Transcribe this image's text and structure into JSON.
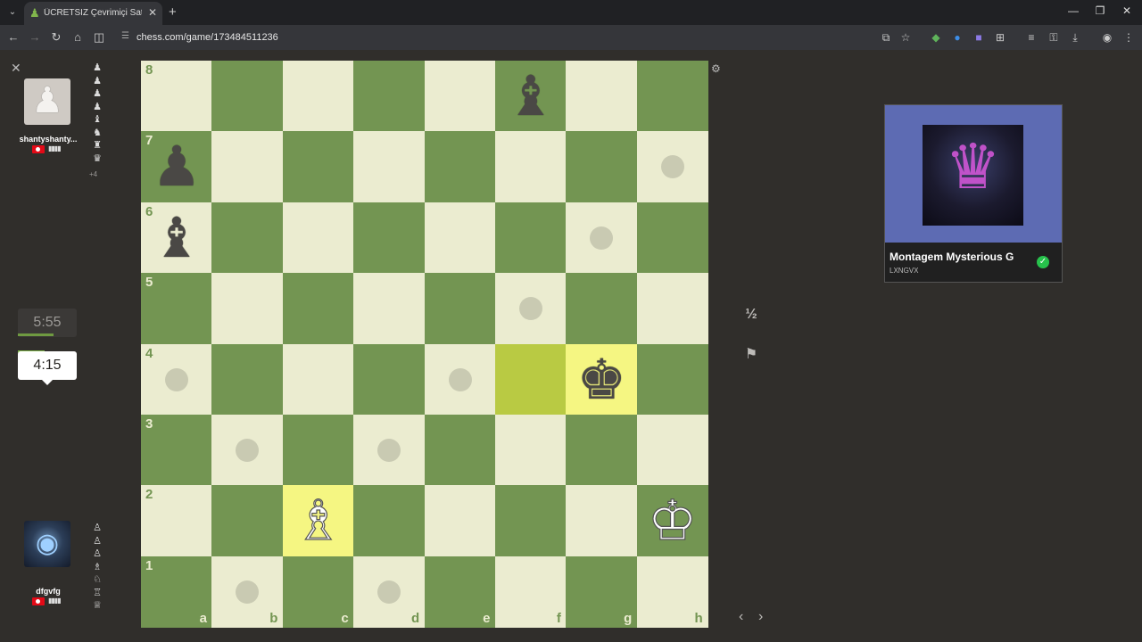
{
  "browser": {
    "tab_title": "ÜCRETSİZ Çevrimiçi Satranç Oy",
    "url": "chess.com/game/173484511236",
    "icons": [
      "tab-list-icon",
      "chess-pawn-favicon",
      "close-icon",
      "plus-icon",
      "minimize-icon",
      "maximize-icon",
      "close-window-icon",
      "back-icon",
      "forward-icon",
      "reload-icon",
      "home-icon",
      "split-view-icon",
      "site-info-icon",
      "install-icon",
      "bookmark-star-icon",
      "extension-icon",
      "extensions-puzzle-icon",
      "password-icon",
      "download-icon",
      "profile-icon",
      "menu-icon"
    ]
  },
  "game": {
    "opponent": {
      "name": "shantyshanty...",
      "clock": "5:55",
      "captured": [
        "♟",
        "♟",
        "♟",
        "♟",
        "♝",
        "♞",
        "♜",
        "♛"
      ],
      "captured_more": "+4"
    },
    "player": {
      "name": "dfgvfg",
      "clock": "4:15",
      "captured": [
        "♙",
        "♙",
        "♙",
        "♗",
        "♘",
        "♖",
        "♕"
      ]
    },
    "board": {
      "light": "#ebecd0",
      "dark": "#739552",
      "highlight_light": "#f5f682",
      "highlight_dark": "#b9ca43",
      "ranks": [
        "8",
        "7",
        "6",
        "5",
        "4",
        "3",
        "2",
        "1"
      ],
      "files": [
        "a",
        "b",
        "c",
        "d",
        "e",
        "f",
        "g",
        "h"
      ],
      "pieces": [
        {
          "square": "f8",
          "glyph": "♝",
          "color": "black"
        },
        {
          "square": "a7",
          "glyph": "♟",
          "color": "black"
        },
        {
          "square": "a6",
          "glyph": "♝",
          "color": "black"
        },
        {
          "square": "g4",
          "glyph": "♚",
          "color": "black"
        },
        {
          "square": "c2",
          "glyph": "♗",
          "color": "white"
        },
        {
          "square": "h2",
          "glyph": "♔",
          "color": "white"
        }
      ],
      "highlights": [
        "f4",
        "g4",
        "c2"
      ],
      "move_hints": [
        "h7",
        "g6",
        "f5",
        "a4",
        "e4",
        "b3",
        "d3",
        "b1",
        "d1"
      ]
    },
    "controls": {
      "draw": "½",
      "resign_icon": "flag-icon",
      "prev": "‹",
      "next": "›"
    }
  },
  "video_card": {
    "title": "Montagem Mysterious G",
    "subtitle": "LXNGVX",
    "verified_icon": "check-circle-icon"
  }
}
